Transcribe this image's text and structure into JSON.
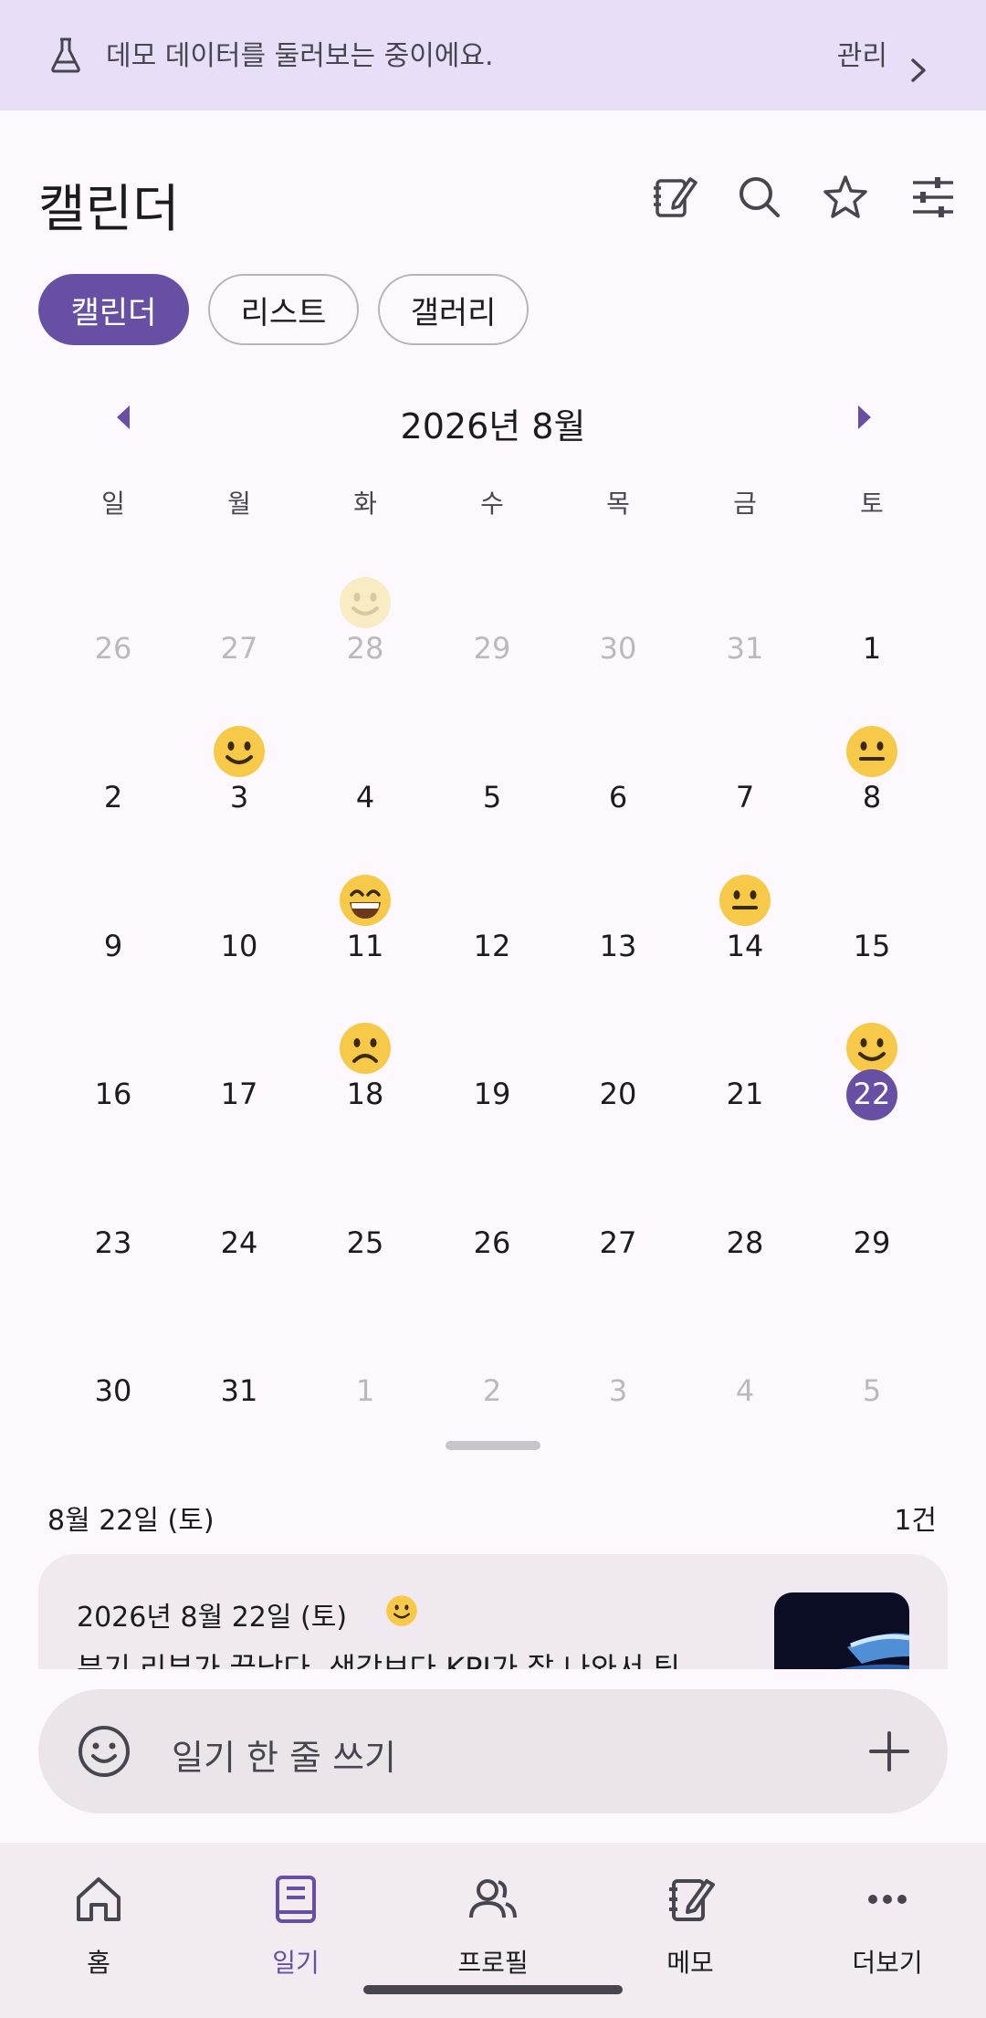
{
  "banner": {
    "text": "데모 데이터를 둘러보는 중이에요.",
    "manage": "관리"
  },
  "header": {
    "title": "캘린더"
  },
  "view_chips": [
    {
      "label": "캘린더",
      "active": true
    },
    {
      "label": "리스트",
      "active": false
    },
    {
      "label": "갤러리",
      "active": false
    }
  ],
  "calendar": {
    "month_label": "2026년 8월",
    "weekdays": [
      "일",
      "월",
      "화",
      "수",
      "목",
      "금",
      "토"
    ],
    "weeks": [
      [
        {
          "d": "26",
          "m": 1
        },
        {
          "d": "27",
          "m": 1
        },
        {
          "d": "28",
          "m": 1,
          "mood": "faded"
        },
        {
          "d": "29",
          "m": 1
        },
        {
          "d": "30",
          "m": 1
        },
        {
          "d": "31",
          "m": 1
        },
        {
          "d": "1"
        }
      ],
      [
        {
          "d": "2"
        },
        {
          "d": "3",
          "mood": "smile"
        },
        {
          "d": "4"
        },
        {
          "d": "5"
        },
        {
          "d": "6"
        },
        {
          "d": "7"
        },
        {
          "d": "8",
          "mood": "neutral"
        }
      ],
      [
        {
          "d": "9"
        },
        {
          "d": "10"
        },
        {
          "d": "11",
          "mood": "grin"
        },
        {
          "d": "12"
        },
        {
          "d": "13"
        },
        {
          "d": "14",
          "mood": "neutral"
        },
        {
          "d": "15"
        }
      ],
      [
        {
          "d": "16"
        },
        {
          "d": "17"
        },
        {
          "d": "18",
          "mood": "sad"
        },
        {
          "d": "19"
        },
        {
          "d": "20"
        },
        {
          "d": "21"
        },
        {
          "d": "22",
          "mood": "smile",
          "selected": true
        }
      ],
      [
        {
          "d": "23"
        },
        {
          "d": "24"
        },
        {
          "d": "25"
        },
        {
          "d": "26"
        },
        {
          "d": "27"
        },
        {
          "d": "28"
        },
        {
          "d": "29"
        }
      ],
      [
        {
          "d": "30"
        },
        {
          "d": "31"
        },
        {
          "d": "1",
          "m": 1
        },
        {
          "d": "2",
          "m": 1
        },
        {
          "d": "3",
          "m": 1
        },
        {
          "d": "4",
          "m": 1
        },
        {
          "d": "5",
          "m": 1
        }
      ]
    ]
  },
  "selected_day": {
    "label": "8월 22일 (토)",
    "count": "1건"
  },
  "entry": {
    "date": "2026년 8월 22일 (토)",
    "text": "분기 리뷰가 끝났다. 생각보다 KPI가 잘 나와서 팀"
  },
  "quick_entry": {
    "placeholder": "일기 한 줄 쓰기"
  },
  "bottom_nav": [
    {
      "label": "홈",
      "icon": "home-icon",
      "active": false
    },
    {
      "label": "일기",
      "icon": "book-icon",
      "active": true
    },
    {
      "label": "프로필",
      "icon": "people-icon",
      "active": false
    },
    {
      "label": "메모",
      "icon": "memo-icon",
      "active": false
    },
    {
      "label": "더보기",
      "icon": "more-icon",
      "active": false
    }
  ],
  "colors": {
    "accent": "#6750a4",
    "banner": "#e8def8",
    "emoji": "#f7c948"
  }
}
